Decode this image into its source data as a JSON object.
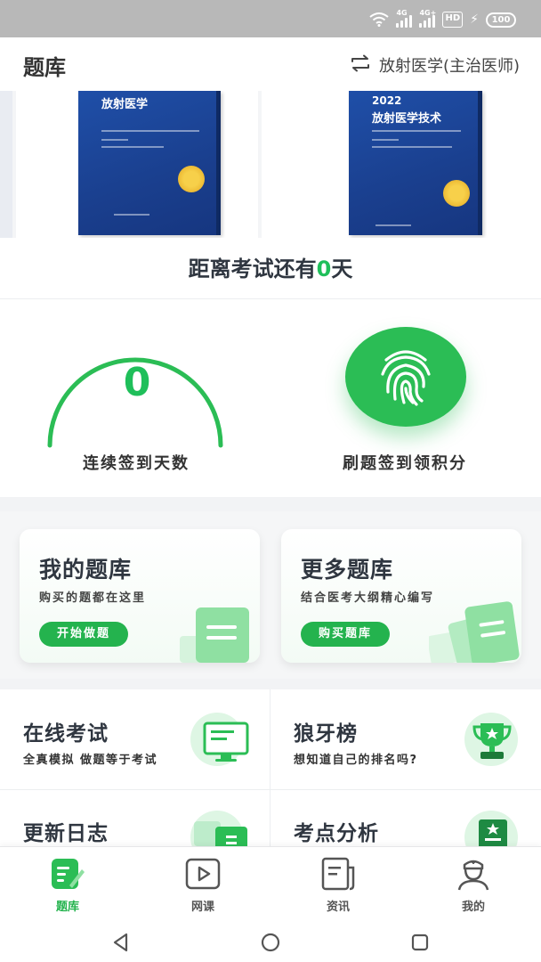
{
  "status_bar": {
    "network_1": "4G",
    "network_2": "4G+",
    "hd": "HD",
    "battery": "100"
  },
  "header": {
    "title": "题库",
    "subject": "放射医学(主治医师)"
  },
  "banner": {
    "books": [
      {
        "title": "放射医学"
      },
      {
        "year": "2022",
        "title": "放射医学技术"
      }
    ]
  },
  "countdown": {
    "prefix": "距离考试还有",
    "days": "0",
    "suffix": "天"
  },
  "sign_in": {
    "streak_days": "0",
    "streak_label": "连续签到天数",
    "checkin_label": "刷题签到领积分"
  },
  "cards": [
    {
      "title": "我的题库",
      "subtitle": "购买的题都在这里",
      "button": "开始做题"
    },
    {
      "title": "更多题库",
      "subtitle": "结合医考大纲精心编写",
      "button": "购买题库"
    }
  ],
  "features": [
    {
      "title": "在线考试",
      "subtitle": "全真模拟 做题等于考试",
      "icon": "monitor-icon"
    },
    {
      "title": "狼牙榜",
      "subtitle": "想知道自己的排名吗?",
      "icon": "trophy-icon"
    },
    {
      "title": "更新日志",
      "subtitle": "",
      "icon": "document-icon"
    },
    {
      "title": "考点分析",
      "subtitle": "",
      "icon": "report-icon"
    }
  ],
  "bottom_nav": [
    {
      "label": "题库",
      "icon": "question-bank-icon",
      "active": true
    },
    {
      "label": "网课",
      "icon": "play-video-icon",
      "active": false
    },
    {
      "label": "资讯",
      "icon": "news-icon",
      "active": false
    },
    {
      "label": "我的",
      "icon": "profile-icon",
      "active": false
    }
  ],
  "colors": {
    "accent": "#24b34e",
    "status_bar": "#b8b8b8",
    "book_blue": "#1f4fa8"
  }
}
